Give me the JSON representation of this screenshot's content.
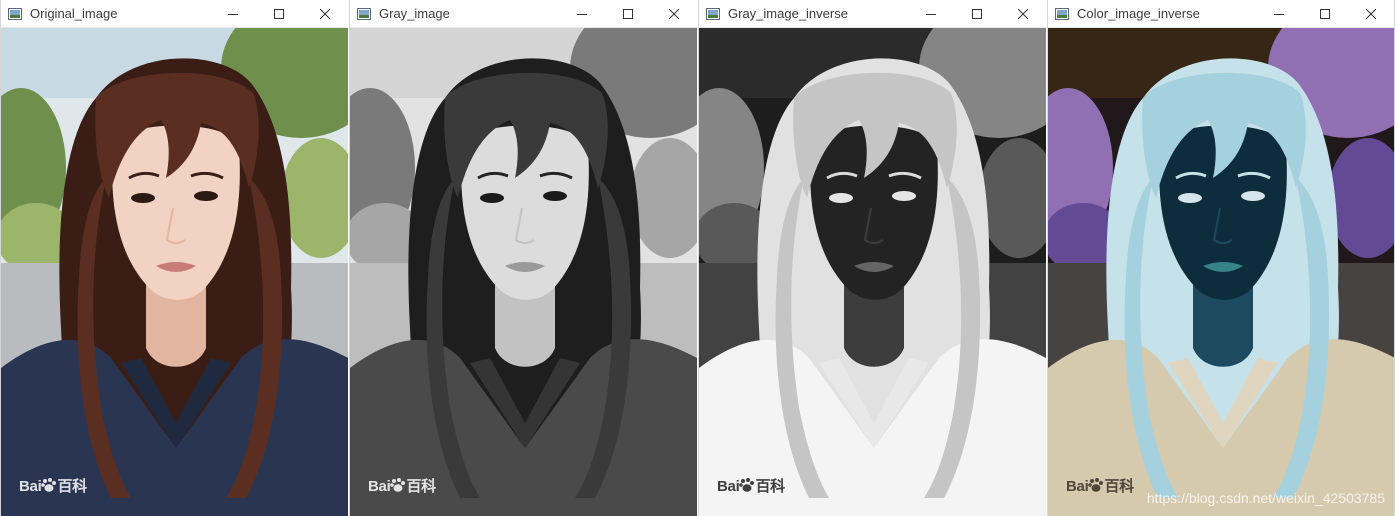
{
  "windows": [
    {
      "title": "Original_image",
      "image_alt": "portrait",
      "filter": "none",
      "watermark_text": "Bai",
      "watermark_text2": "百科",
      "watermark_color": "#ffffff"
    },
    {
      "title": "Gray_image",
      "image_alt": "portrait",
      "filter": "gray",
      "watermark_text": "Bai",
      "watermark_text2": "百科",
      "watermark_color": "#ffffff"
    },
    {
      "title": "Gray_image_inverse",
      "image_alt": "portrait",
      "filter": "gray-invert",
      "watermark_text": "Bai",
      "watermark_text2": "百科",
      "watermark_color": "#202020"
    },
    {
      "title": "Color_image_inverse",
      "image_alt": "portrait",
      "filter": "color-invert",
      "watermark_text": "Bai",
      "watermark_text2": "百科",
      "watermark_color": "#3a3028",
      "url_watermark": "https://blog.csdn.net/weixin_42503785"
    }
  ],
  "controls": {
    "minimize_icon": "minimize-icon",
    "maximize_icon": "maximize-icon",
    "close_icon": "close-icon"
  }
}
